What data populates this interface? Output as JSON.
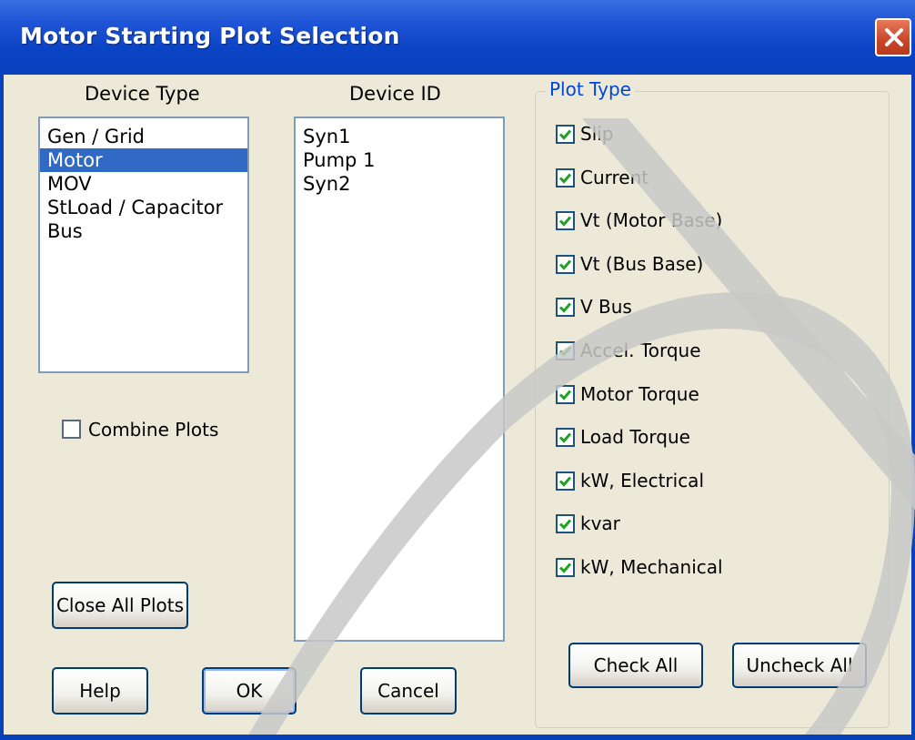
{
  "window": {
    "title": "Motor Starting Plot Selection"
  },
  "device_type": {
    "header": "Device Type",
    "items": [
      "Gen / Grid",
      "Motor",
      "MOV",
      "StLoad / Capacitor",
      "Bus"
    ],
    "selected": "Motor"
  },
  "device_id": {
    "header": "Device ID",
    "items": [
      "Syn1",
      "Pump 1",
      "Syn2"
    ]
  },
  "combine_plots": {
    "label": "Combine Plots",
    "checked": false
  },
  "plot_type": {
    "title": "Plot Type",
    "options": [
      {
        "label": "Slip",
        "checked": true
      },
      {
        "label": "Current",
        "checked": true
      },
      {
        "label": "Vt (Motor Base)",
        "checked": true
      },
      {
        "label": "Vt (Bus Base)",
        "checked": true
      },
      {
        "label": "V Bus",
        "checked": true
      },
      {
        "label": "Accel. Torque",
        "checked": true
      },
      {
        "label": "Motor Torque",
        "checked": true
      },
      {
        "label": "Load Torque",
        "checked": true
      },
      {
        "label": "kW, Electrical",
        "checked": true
      },
      {
        "label": "kvar",
        "checked": true
      },
      {
        "label": "kW, Mechanical",
        "checked": true
      }
    ]
  },
  "buttons": {
    "close_all_plots": "Close All Plots",
    "help": "Help",
    "ok": "OK",
    "cancel": "Cancel",
    "check_all": "Check All",
    "uncheck_all": "Uncheck All"
  },
  "colors": {
    "title_bar": "#0a43c4",
    "selection": "#316ac5",
    "group_title": "#0046d5",
    "check": "#21a121",
    "close_button": "#c8452a"
  },
  "icons": {
    "close": "close-icon",
    "checkmark": "checkmark-icon"
  }
}
